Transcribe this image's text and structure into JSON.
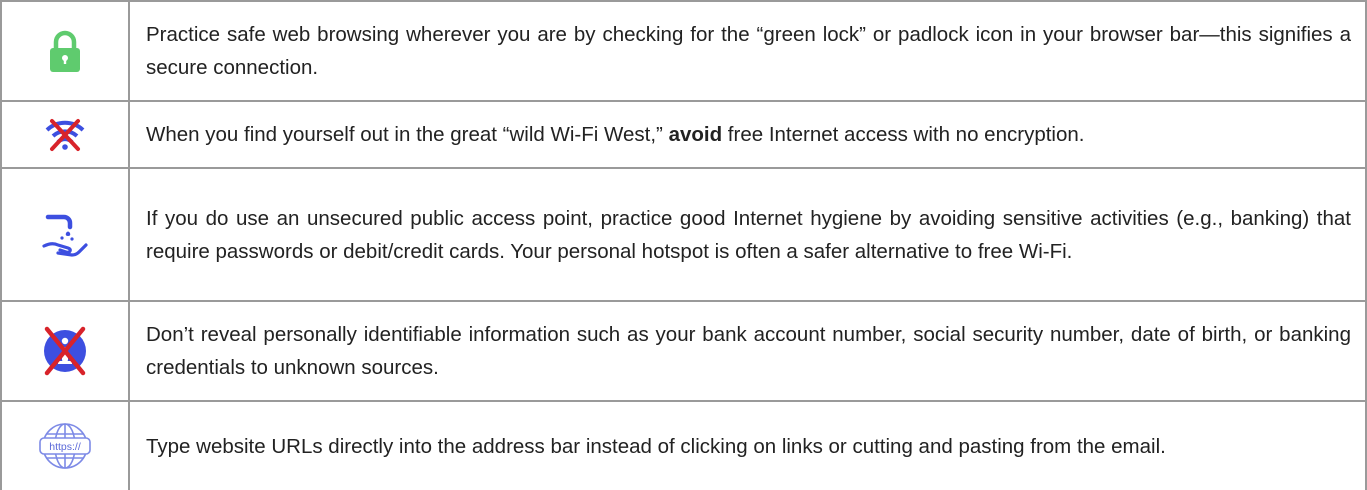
{
  "tips": [
    {
      "icon": "green-padlock-icon",
      "text": "Practice safe web browsing wherever you are by checking for the “green lock” or padlock icon in your browser bar—this signifies a secure connection."
    },
    {
      "icon": "crossed-out-wifi-icon",
      "text_before": "When you find yourself out in the great “wild Wi-Fi West,” ",
      "text_bold": "avoid",
      "text_after": " free Internet access with no encryption."
    },
    {
      "icon": "hand-washing-icon",
      "text": "If you do use an unsecured public access point, practice good Internet hygiene by avoiding sensitive activities (e.g., banking) that require passwords or debit/credit cards. Your personal hotspot is often a safer alternative to free Wi-Fi."
    },
    {
      "icon": "crossed-out-info-icon",
      "text": "Don’t reveal personally identifiable information such as your bank account number, social security number, date of birth, or banking credentials to unknown sources."
    },
    {
      "icon": "https-globe-icon",
      "icon_label": "https://",
      "text": "Type website URLs directly into the address bar instead of clicking on links or cutting and pasting from the email."
    }
  ],
  "colors": {
    "lock_green": "#5fcb6e",
    "icon_blue": "#3d4fe0",
    "cross_red": "#d8232a",
    "globe_blue": "#7d8ae6",
    "border_gray": "#9a9a9a"
  }
}
